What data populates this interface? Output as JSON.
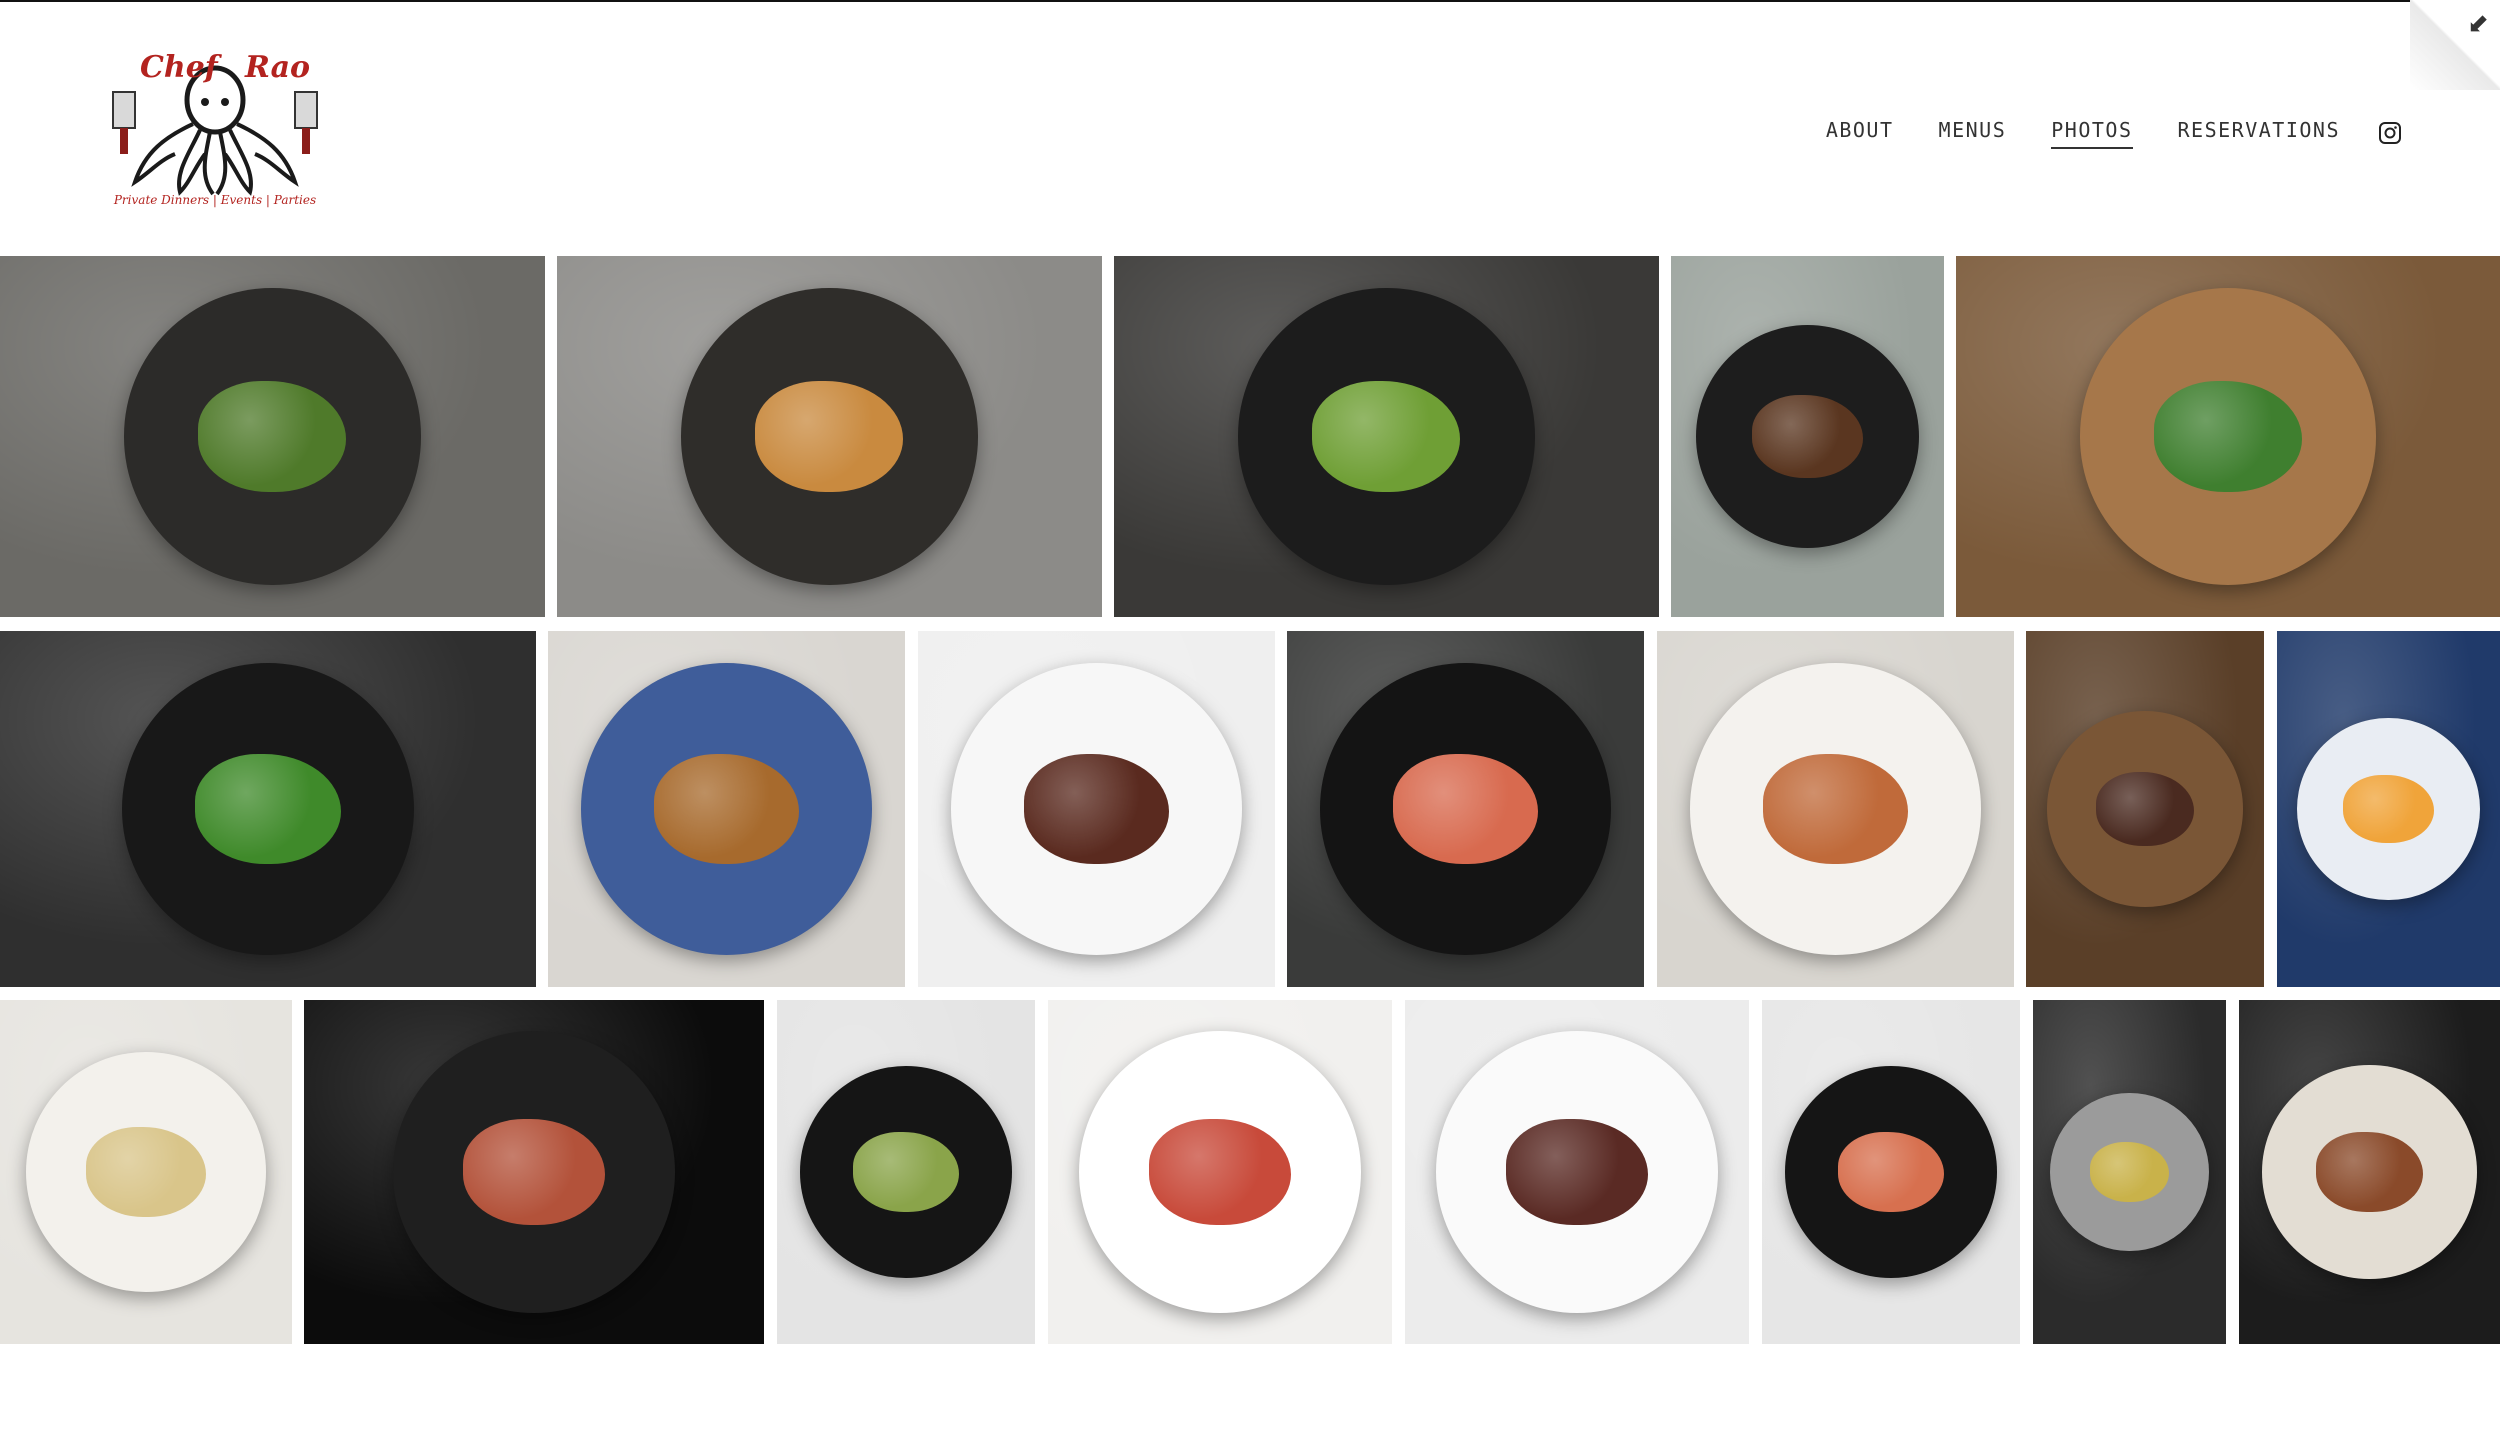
{
  "brand": {
    "name_part1": "Chef",
    "name_part2": "Rao",
    "tagline": "Private Dinners | Events | Parties",
    "colors": {
      "accent": "#b3231f",
      "ink": "#1a1a1a"
    }
  },
  "nav": {
    "items": [
      {
        "label": "ABOUT",
        "active": false
      },
      {
        "label": "MENUS",
        "active": false
      },
      {
        "label": "PHOTOS",
        "active": true
      },
      {
        "label": "RESERVATIONS",
        "active": false
      }
    ],
    "instagram_icon": "instagram-icon"
  },
  "corner": {
    "icon": "collapse-arrow-icon",
    "glyph": "⬋"
  },
  "gallery": {
    "rows": [
      {
        "tiles": [
          {
            "name": "photo-steak-chimichurri",
            "bg": "#6b6a66",
            "plate": "#2c2b29",
            "food": "#4f7a2a"
          },
          {
            "name": "photo-rice-timbales",
            "bg": "#8c8b88",
            "plate": "#2f2d2a",
            "food": "#c98a3f"
          },
          {
            "name": "photo-shishito-peppers-pan",
            "bg": "#3a3937",
            "plate": "#1c1c1c",
            "food": "#6f9f35"
          },
          {
            "name": "photo-plated-lamb",
            "bg": "#9aa29c",
            "plate": "#1d1d1d",
            "food": "#5a3620"
          },
          {
            "name": "photo-cutting-board-ingredients",
            "bg": "#7b5a3a",
            "plate": "#a6774a",
            "food": "#3f7f2f"
          }
        ]
      },
      {
        "tiles": [
          {
            "name": "photo-chimichurri-bowl-stove",
            "bg": "#2f2f2f",
            "plate": "#181818",
            "food": "#3f8a2a"
          },
          {
            "name": "photo-shrimp-curry-avocado",
            "bg": "#d9d6d1",
            "plate": "#3f5d9a",
            "food": "#a76a2d"
          },
          {
            "name": "photo-octopus-steak-plantain",
            "bg": "#efefef",
            "plate": "#f7f7f7",
            "food": "#5a2a1f"
          },
          {
            "name": "photo-salmon-toast",
            "bg": "#3a3b3a",
            "plate": "#141414",
            "food": "#d86a4f"
          },
          {
            "name": "photo-scallops-plate",
            "bg": "#d8d5cf",
            "plate": "#f4f2ee",
            "food": "#c06a3a"
          },
          {
            "name": "photo-steak-slicing",
            "bg": "#5a3f28",
            "plate": "#7a5636",
            "food": "#4a2a20"
          },
          {
            "name": "photo-fried-egg-plate",
            "bg": "#203a6a",
            "plate": "#e9edf3",
            "food": "#f0a43a"
          }
        ]
      },
      {
        "tiles": [
          {
            "name": "photo-halibut-sauce",
            "bg": "#e6e4df",
            "plate": "#f3f1ec",
            "food": "#d9c58a"
          },
          {
            "name": "photo-steak-tartare-board",
            "bg": "#0c0c0c",
            "plate": "#1f1f1f",
            "food": "#b3523a"
          },
          {
            "name": "photo-shrimp-salad",
            "bg": "#e4e4e4",
            "plate": "#151515",
            "food": "#8aa44a"
          },
          {
            "name": "photo-shrimp-octopus-bruschetta",
            "bg": "#f1f0ee",
            "plate": "#ffffff",
            "food": "#c84a3a"
          },
          {
            "name": "photo-octopus-steak-plate",
            "bg": "#ececec",
            "plate": "#fafafa",
            "food": "#5a2a24"
          },
          {
            "name": "photo-salmon-bruschetta-black-plate",
            "bg": "#e6e6e6",
            "plate": "#151515",
            "food": "#d7704f"
          },
          {
            "name": "photo-yellow-rice-pot",
            "bg": "#2b2b2b",
            "plate": "#9b9b9b",
            "food": "#c9b24a"
          },
          {
            "name": "photo-pork-chop-plate",
            "bg": "#1c1c1c",
            "plate": "#e3ddd3",
            "food": "#8a4a2a"
          }
        ]
      }
    ]
  }
}
